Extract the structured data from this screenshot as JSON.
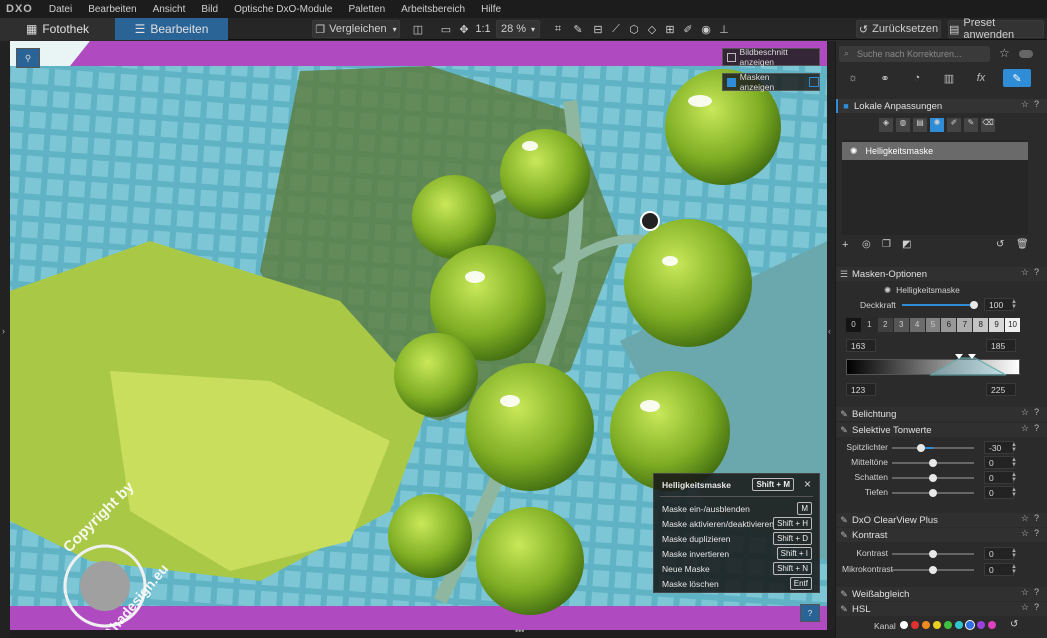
{
  "menu": {
    "logo": "DXO",
    "items": [
      "Datei",
      "Bearbeiten",
      "Ansicht",
      "Bild",
      "Optische DxO-Module",
      "Paletten",
      "Arbeitsbereich",
      "Hilfe"
    ]
  },
  "toolbar": {
    "tab_library": "Fotothek",
    "tab_edit": "Bearbeiten",
    "compare": "Vergleichen",
    "zoom_1_1": "1:1",
    "zoom": "28 %",
    "reset": "Zurücksetzen",
    "preset": "Preset anwenden"
  },
  "viewer": {
    "show_crop": "Bildbeschnitt anzeigen",
    "show_masks": "Masken anzeigen",
    "help_button": "?",
    "watermark_top": "Copyright by",
    "watermark_bottom": "Ahadesign.eu"
  },
  "overlay": {
    "title": "Helligkeitsmaske",
    "title_key": "Shift + M",
    "close": "×",
    "rows": [
      {
        "label": "Maske ein-/ausblenden",
        "key": "M"
      },
      {
        "label": "Maske aktivieren/deaktivieren",
        "key": "Shift + H"
      },
      {
        "label": "Maske duplizieren",
        "key": "Shift + D"
      },
      {
        "label": "Maske invertieren",
        "key": "Shift + I"
      },
      {
        "label": "Neue Maske",
        "key": "Shift + N"
      },
      {
        "label": "Maske löschen",
        "key": "Entf"
      }
    ]
  },
  "panel": {
    "search_placeholder": "Suche nach Korrekturen...",
    "local": {
      "title": "Lokale Anpassungen",
      "selected_mask": "Helligkeitsmaske"
    },
    "mask_options": {
      "title": "Masken-Optionen",
      "mask_name": "Helligkeitsmaske",
      "opacity_label": "Deckkraft",
      "opacity_value": "100",
      "opacity": 1.0,
      "zones": [
        "0",
        "1",
        "2",
        "3",
        "4",
        "5",
        "6",
        "7",
        "8",
        "9",
        "10"
      ],
      "range_low": "163",
      "range_high": "185",
      "tol_low": "123",
      "tol_high": "225"
    },
    "sections": {
      "exposure": "Belichtung",
      "selective_tone": "Selektive Tonwerte",
      "clearview": "DxO ClearView Plus",
      "contrast": "Kontrast",
      "whitebalance": "Weißabgleich",
      "hsl": "HSL"
    },
    "selective_tone": [
      {
        "label": "Spitzlichter",
        "value": "-30",
        "level": -0.3
      },
      {
        "label": "Mitteltöne",
        "value": "0",
        "level": 0
      },
      {
        "label": "Schatten",
        "value": "0",
        "level": 0
      },
      {
        "label": "Tiefen",
        "value": "0",
        "level": 0
      }
    ],
    "contrast": [
      {
        "label": "Kontrast",
        "value": "0",
        "level": 0
      },
      {
        "label": "Mikrokontrast",
        "value": "0",
        "level": 0
      }
    ],
    "hsl": {
      "channel_label": "Kanal"
    },
    "colors": {
      "accent": "#2f8cd6"
    }
  }
}
